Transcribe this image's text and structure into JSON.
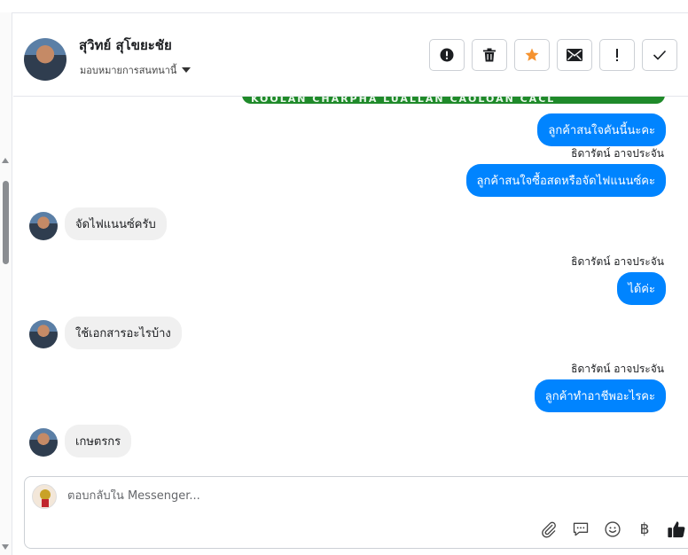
{
  "header": {
    "contact_name": "สุวิทย์ สุโขยะชัย",
    "assign_label": "มอบหมายการสนทนานี้",
    "actions": [
      {
        "name": "report-spam-button",
        "icon": "exclamation-circle-icon"
      },
      {
        "name": "delete-button",
        "icon": "trash-icon"
      },
      {
        "name": "star-button",
        "icon": "star-icon"
      },
      {
        "name": "mark-unread-button",
        "icon": "envelope-icon"
      },
      {
        "name": "follow-up-button",
        "icon": "exclamation-icon"
      },
      {
        "name": "mark-done-button",
        "icon": "check-icon"
      }
    ]
  },
  "card_banner_text": "KOOLAN CHARPHA LUALLAN CAOLOAN CACL",
  "messages": [
    {
      "dir": "out",
      "text": "ลูกค้าสนใจคันนี้นะคะ"
    },
    {
      "dir": "out",
      "sender": "ธิดารัตน์ อาจประจัน",
      "text": "ลูกค้าสนใจซื้อสดหรือจัดไฟแนนซ์คะ"
    },
    {
      "dir": "in",
      "text": "จัดไฟแนนซ์ครับ"
    },
    {
      "dir": "out",
      "sender": "ธิดารัตน์ อาจประจัน",
      "text": "ได้ค่ะ"
    },
    {
      "dir": "in",
      "text": "ใช้เอกสารอะไรบ้าง"
    },
    {
      "dir": "out",
      "sender": "ธิดารัตน์ อาจประจัน",
      "text": "ลูกค้าทำอาชีพอะไรคะ"
    },
    {
      "dir": "in",
      "text": "เกษตรกร"
    }
  ],
  "composer": {
    "placeholder": "ตอบกลับใน Messenger...",
    "tools": [
      "paperclip-icon",
      "chat-bubble-icon",
      "smiley-icon",
      "baht-icon",
      "thumbs-up-icon"
    ],
    "baht_symbol": "฿"
  },
  "colors": {
    "outgoing_bubble": "#0084ff",
    "incoming_bubble": "#f0f0f0",
    "star": "#f5922f",
    "card_green": "#1f8a2a"
  }
}
